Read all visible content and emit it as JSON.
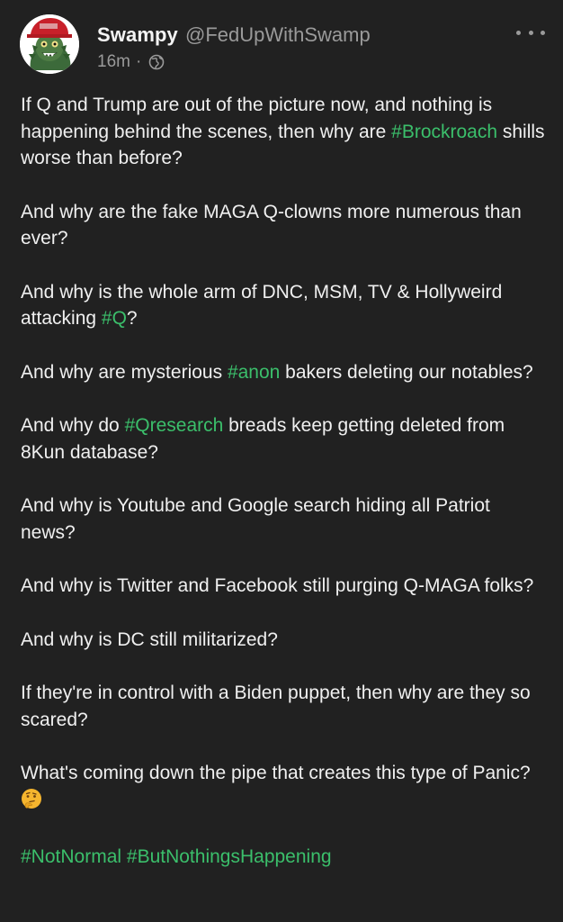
{
  "author": {
    "name": "Swampy",
    "handle": "@FedUpWithSwamp",
    "time": "16m",
    "separator": "·",
    "visibility_icon": "globe-icon"
  },
  "actions": {
    "more_icon": "more-dots-icon"
  },
  "post": {
    "p1": {
      "a": "If Q and Trump are out of the picture now, and nothing is happening behind the scenes, then why are ",
      "tag1": "#Brockroach",
      "b": " shills worse than before?"
    },
    "p2": {
      "a": "And why are the fake MAGA Q-clowns more numerous than ever?"
    },
    "p3": {
      "a": "And why is the whole arm of DNC, MSM, TV & Hollyweird attacking ",
      "tag1": "#Q",
      "b": "?"
    },
    "p4": {
      "a": "And why are mysterious ",
      "tag1": "#anon",
      "b": " bakers deleting our notables?"
    },
    "p5": {
      "a": "And why do ",
      "tag1": "#Qresearch",
      "b": " breads keep getting deleted from 8Kun database?"
    },
    "p6": {
      "a": "And why is Youtube and Google search hiding all Patriot news?"
    },
    "p7": {
      "a": "And why is Twitter and Facebook still purging Q-MAGA folks?"
    },
    "p8": {
      "a": "And why is DC still militarized?"
    },
    "p9": {
      "a": "If they're in control with a Biden puppet, then why are they so scared?"
    },
    "p10": {
      "a": "What's coming down the pipe that creates this type of Panic? ",
      "emoji": "thinking-face-icon"
    },
    "p11": {
      "tag1": "#NotNormal",
      "sep": " ",
      "tag2": "#ButNothingsHappening"
    }
  },
  "colors": {
    "background": "#212121",
    "text": "#f0f0f0",
    "muted": "#9a9a9a",
    "hashtag": "#3bbf6b"
  }
}
